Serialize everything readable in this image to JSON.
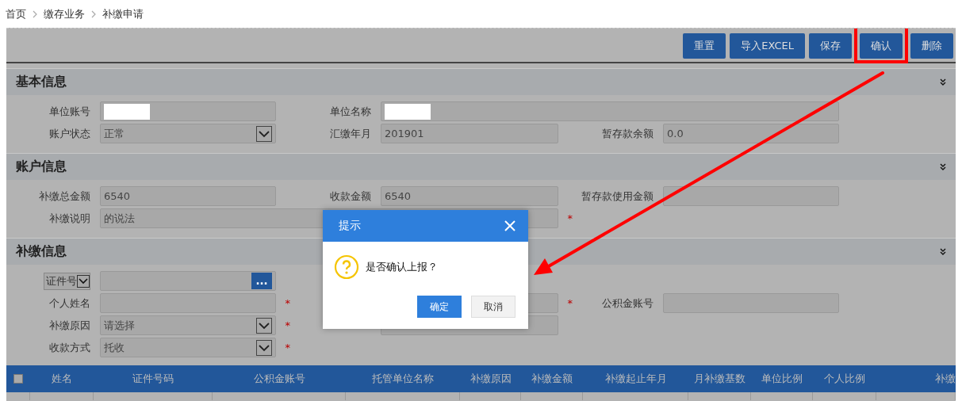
{
  "breadcrumb": [
    "首页",
    "缴存业务",
    "补缴申请"
  ],
  "toolbar": {
    "buttons": [
      {
        "label": "重置",
        "annotated": false
      },
      {
        "label": "导入EXCEL",
        "annotated": false
      },
      {
        "label": "保存",
        "annotated": false
      },
      {
        "label": "确认",
        "annotated": true
      },
      {
        "label": "删除",
        "annotated": false
      }
    ]
  },
  "sections": [
    {
      "title": "基本信息",
      "rows": [
        [
          {
            "kind": "input",
            "label": "单位账号",
            "redacted": true
          },
          {
            "kind": "wide-input",
            "label": "单位名称",
            "redacted": true
          }
        ],
        [
          {
            "kind": "select",
            "label": "账户状态",
            "value": "正常"
          },
          {
            "kind": "input",
            "label": "汇缴年月",
            "value": "201901"
          },
          {
            "kind": "input",
            "label": "暂存款余额",
            "value": "0.0"
          }
        ]
      ]
    },
    {
      "title": "账户信息",
      "rows": [
        [
          {
            "kind": "input",
            "label": "补缴总金额",
            "value": "6540"
          },
          {
            "kind": "input",
            "label": "收款金额",
            "value": "6540"
          },
          {
            "kind": "input",
            "label": "暂存款使用金额"
          }
        ],
        [
          {
            "kind": "wide-input",
            "label": "补缴说明",
            "value": "的说法",
            "mark": "*"
          }
        ]
      ]
    },
    {
      "title": "补缴信息",
      "rows": [
        [
          {
            "kind": "lookup",
            "selector": "证件号",
            "button": "..."
          }
        ],
        [
          {
            "kind": "input",
            "label": "个人姓名",
            "mark": "*"
          },
          {
            "kind": "input",
            "mark": "*"
          },
          {
            "kind": "input",
            "label": "公积金账号"
          }
        ],
        [
          {
            "kind": "select",
            "label": "补缴原因",
            "value": "请选择",
            "mark": "*"
          },
          {
            "kind": "input"
          }
        ],
        [
          {
            "kind": "select",
            "label": "收款方式",
            "value": "托收",
            "mark": "*"
          }
        ]
      ]
    }
  ],
  "table": {
    "select_all_checked": false,
    "columns": [
      "姓名",
      "证件号码",
      "公积金账号",
      "托管单位名称",
      "补缴原因",
      "补缴金额",
      "补缴起止年月",
      "月补缴基数",
      "单位比例",
      "个人比例",
      "补缴"
    ]
  },
  "dialog": {
    "title": "提示",
    "message": "是否确认上报？",
    "buttons": [
      {
        "label": "确定",
        "primary": true
      },
      {
        "label": "取消",
        "primary": false
      }
    ]
  }
}
